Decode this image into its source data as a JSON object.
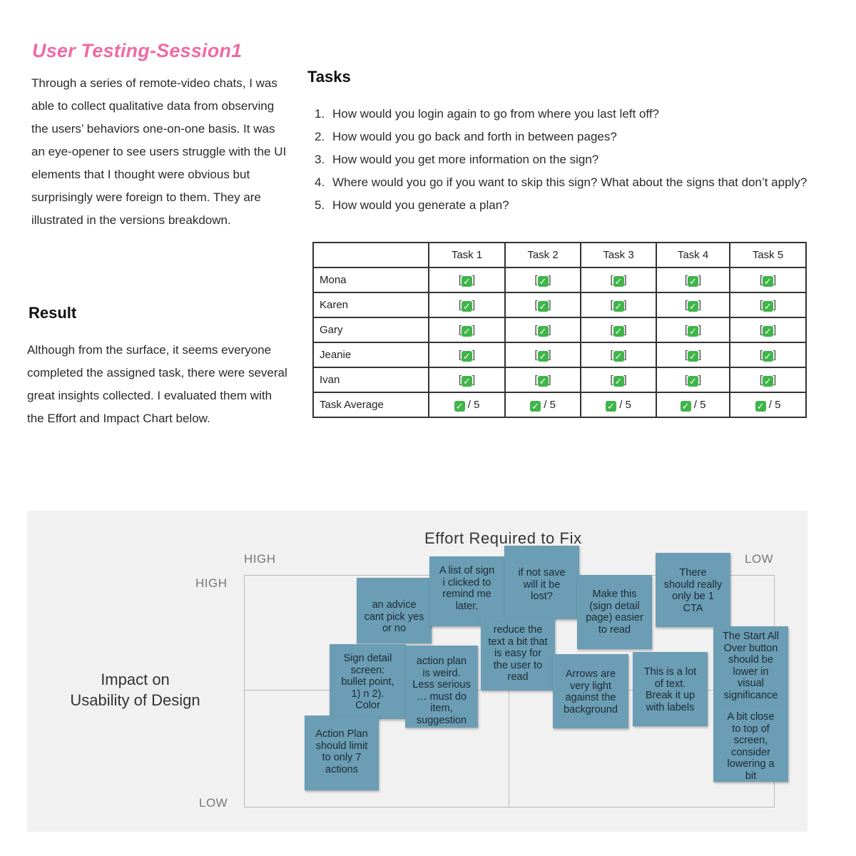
{
  "title": "User Testing-Session1",
  "intro": "Through a series of remote-video chats, I was able to collect qualitative data from observing the users’ behaviors one-on-one basis. It was an eye-opener to see users struggle with the UI elements that I thought were obvious but surprisingly were foreign to them.  They are illustrated in the versions breakdown.",
  "result": {
    "heading": "Result",
    "text": "Although from the surface, it seems everyone completed the assigned task, there were several great insights collected.  I evaluated them with the Effort and Impact Chart below."
  },
  "tasks": {
    "heading": "Tasks",
    "items": [
      {
        "num": "1.",
        "text": "How would you login again to go from where you last left off?"
      },
      {
        "num": "2.",
        "text": "How would you go back and forth in between pages?"
      },
      {
        "num": "3.",
        "text": "How would you get more information on the sign?"
      },
      {
        "num": "4.",
        "text": "Where would you go if you want to skip this sign? What about the signs that don’t apply?"
      },
      {
        "num": "5.",
        "text": "How would you generate a plan?"
      }
    ]
  },
  "table": {
    "columns": [
      "Task 1",
      "Task 2",
      "Task 3",
      "Task 4",
      "Task 5"
    ],
    "rows": [
      "Mona",
      "Karen",
      "Gary",
      "Jeanie",
      "Ivan"
    ],
    "average_label": "Task Average",
    "cell_open": "[",
    "cell_close": "]",
    "check_glyph": "✓",
    "average_suffix": "/ 5"
  },
  "chart": {
    "title": "Effort Required to Fix",
    "x_high": "HIGH",
    "x_low": "LOW",
    "y_high": "HIGH",
    "y_low": "LOW",
    "y_title": "Impact on\nUsability of Design",
    "notes": [
      "an advice\ncant pick yes\nor no",
      "A list of sign\ni clicked to\nremind me\nlater.",
      "if not save\nwill it be\nlost?",
      "Make this\n(sign detail\npage) easier\nto read",
      "There\nshould really\nonly be 1\nCTA",
      "reduce the\ntext a bit that\nis easy for\nthe user to\nread",
      "Sign detail\nscreen:\nbullet point,\n1) n 2).\nColor",
      "action plan\nis weird.\nLess serious\n… must do\nitem,\nsuggestion",
      "Arrows are\nvery light\nagainst the\nbackground",
      "This is a lot\nof text.\nBreak it up\nwith labels",
      "The Start All\nOver button\nshould be\nlower in\nvisual\nsignificance",
      "A bit close\nto top of\nscreen,\nconsider\nlowering a\nbit",
      "Action Plan\nshould limit\nto only 7\nactions"
    ]
  }
}
